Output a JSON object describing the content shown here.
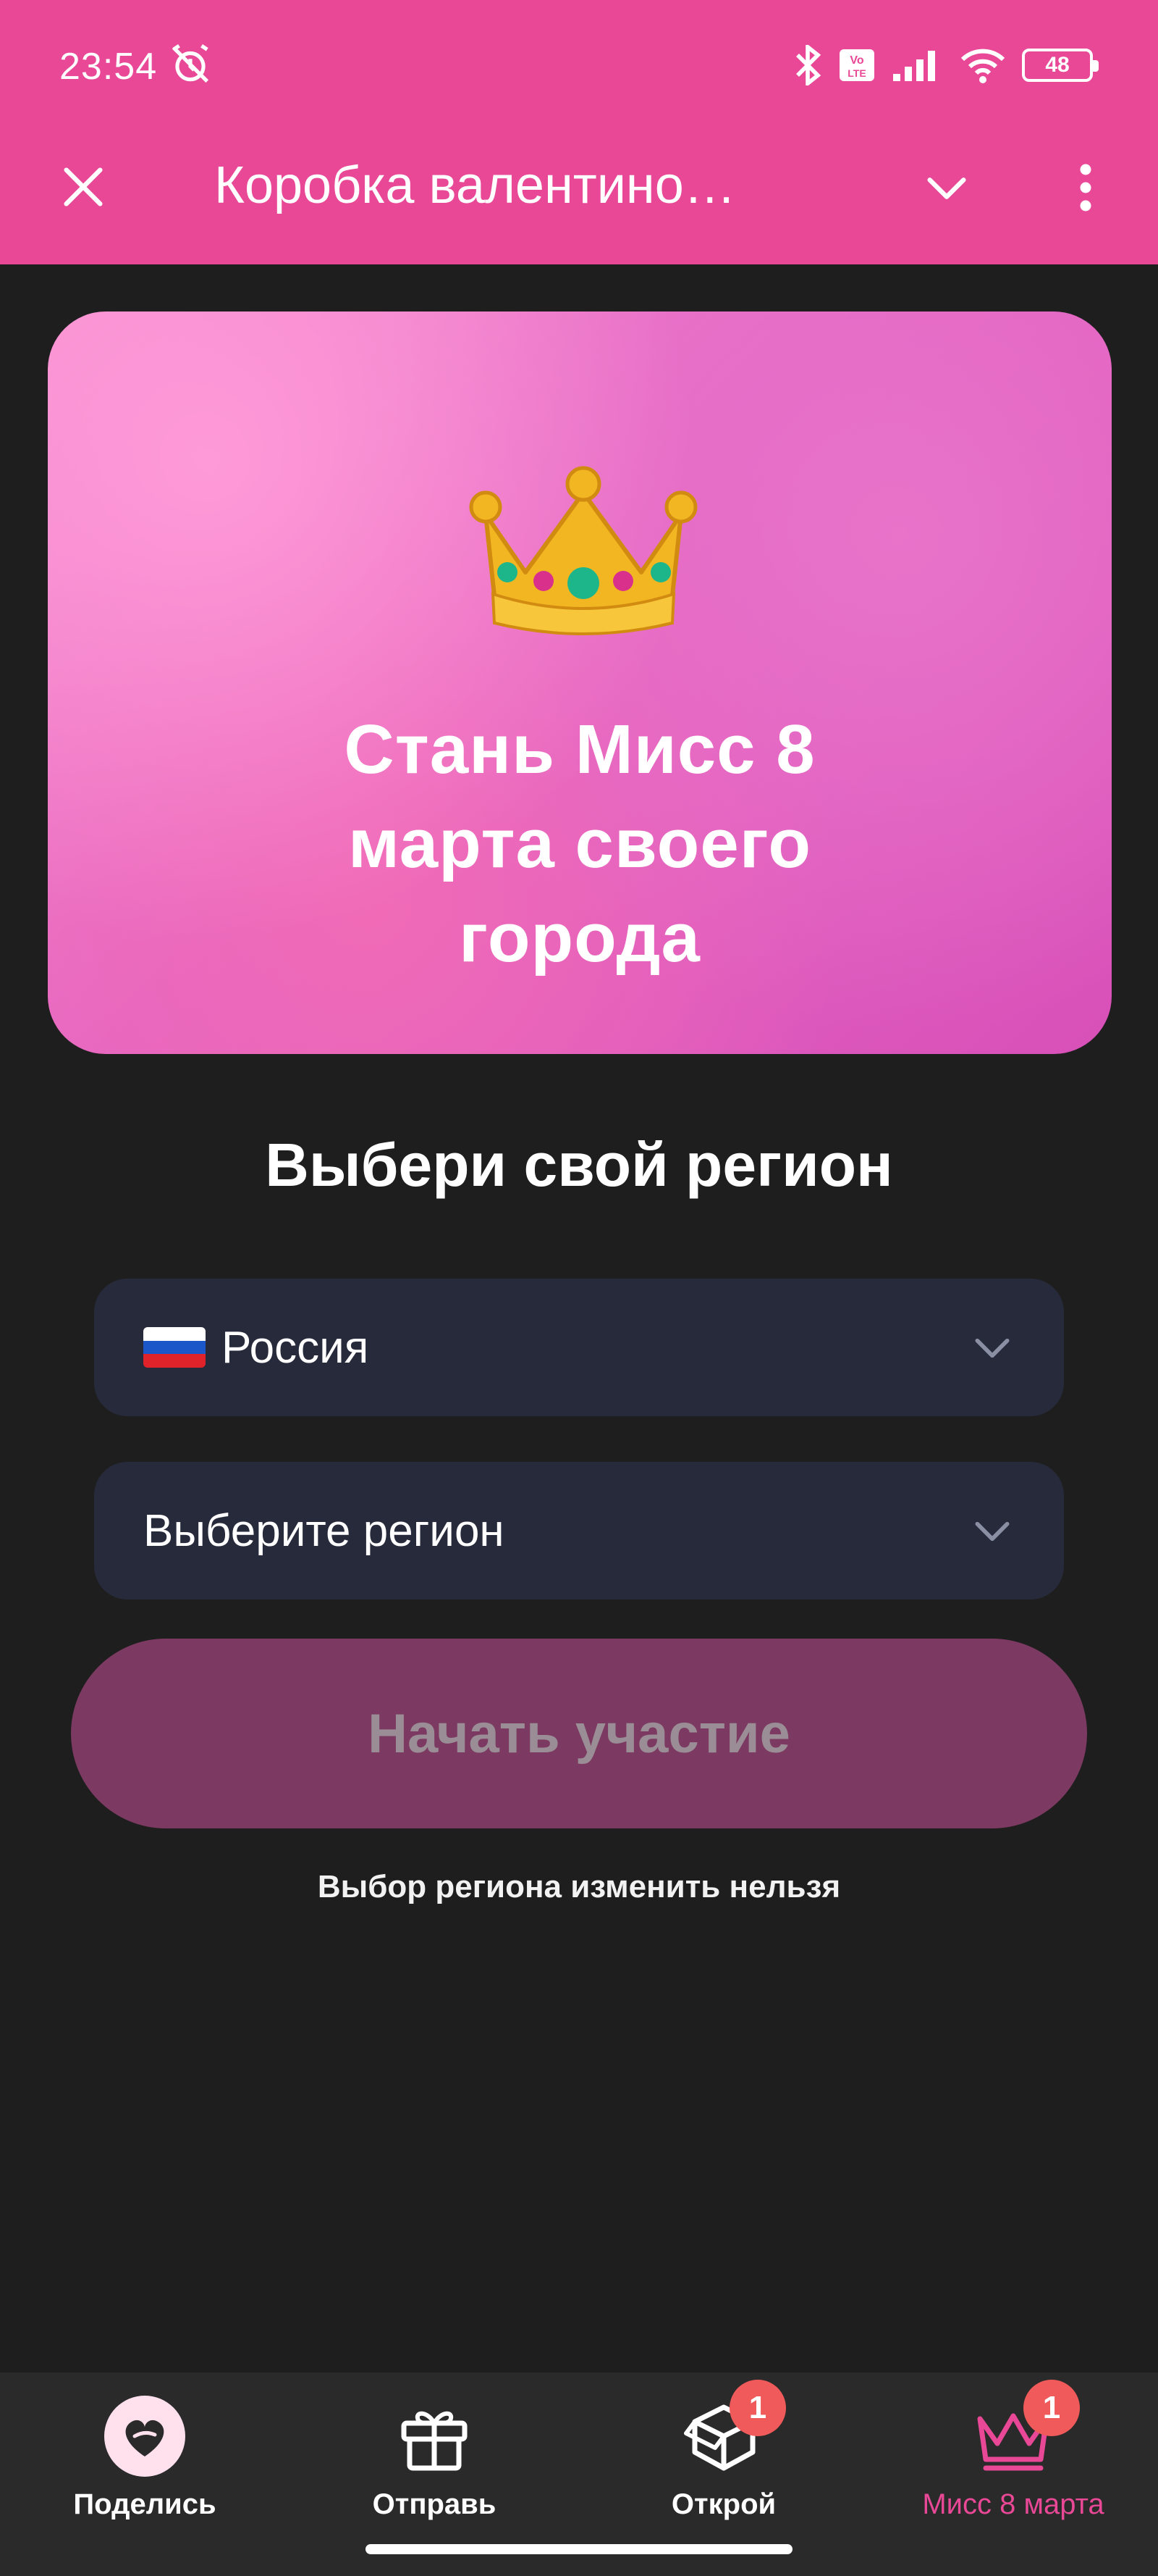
{
  "status_bar": {
    "time": "23:54",
    "battery": "48",
    "icons": [
      "alarm-off-icon",
      "bluetooth-icon",
      "volte-icon",
      "signal-icon",
      "wifi-icon",
      "battery-icon"
    ]
  },
  "app_bar": {
    "title": "Коробка валентино…",
    "icons": [
      "close-icon",
      "chevron-down-icon",
      "more-vert-icon"
    ]
  },
  "banner": {
    "icon": "crown-icon",
    "title_line1": "Стань Мисс 8",
    "title_line2": "марта своего",
    "title_line3": "города"
  },
  "region_form": {
    "heading": "Выбери свой регион",
    "country_select": {
      "value": "Россия",
      "flag": "russia-flag-icon"
    },
    "region_select": {
      "placeholder": "Выберите регион"
    },
    "submit_label": "Начать участие",
    "note": "Выбор региона изменить нельзя"
  },
  "bottom_nav": {
    "items": [
      {
        "label": "Поделись",
        "icon": "heart-share-icon",
        "badge": null,
        "active": false
      },
      {
        "label": "Отправь",
        "icon": "gift-icon",
        "badge": null,
        "active": false
      },
      {
        "label": "Открой",
        "icon": "box-icon",
        "badge": "1",
        "active": false
      },
      {
        "label": "Мисс 8 марта",
        "icon": "crown-outline-icon",
        "badge": "1",
        "active": true
      }
    ]
  },
  "colors": {
    "brand_pink": "#e84896",
    "background": "#1e1e1e",
    "select_bg": "#272a3b",
    "cta_disabled_bg": "#7c3a62",
    "badge": "#f05a5a"
  }
}
